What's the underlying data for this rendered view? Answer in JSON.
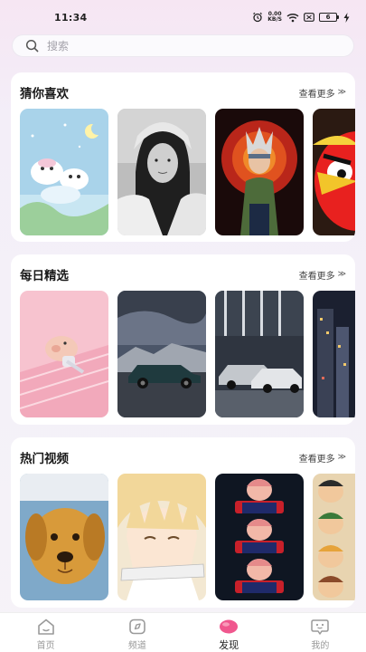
{
  "status_bar": {
    "time": "11:34",
    "net_speed_value": "0.00",
    "net_speed_unit": "KB/S",
    "battery": "6"
  },
  "search": {
    "placeholder": "搜索"
  },
  "sections": [
    {
      "title": "猜你喜欢",
      "more_label": "查看更多",
      "more_arrow": "≫",
      "items": [
        {
          "subject": "cartoon-puppies-sky"
        },
        {
          "subject": "woman-portrait-bw"
        },
        {
          "subject": "anime-ninja-red"
        },
        {
          "subject": "angry-bird-plush"
        }
      ]
    },
    {
      "title": "每日精选",
      "more_label": "查看更多",
      "more_arrow": "≫",
      "items": [
        {
          "subject": "pink-piglet"
        },
        {
          "subject": "classic-car-cloudy"
        },
        {
          "subject": "sports-car-garage"
        },
        {
          "subject": "city-night"
        }
      ]
    },
    {
      "title": "热门视频",
      "more_label": "查看更多",
      "more_arrow": "≫",
      "items": [
        {
          "subject": "golden-retriever"
        },
        {
          "subject": "anime-boy-blond"
        },
        {
          "subject": "anime-jujutsu-triple"
        },
        {
          "subject": "anime-group"
        }
      ]
    }
  ],
  "tab_bar": {
    "items": [
      {
        "label": "首页",
        "icon": "home-icon"
      },
      {
        "label": "频道",
        "icon": "channel-icon"
      },
      {
        "label": "发现",
        "icon": "discover-icon",
        "active": true
      },
      {
        "label": "我的",
        "icon": "profile-icon"
      }
    ]
  },
  "colors": {
    "accent": "#f0578e",
    "inactive": "#9a9a9a"
  }
}
